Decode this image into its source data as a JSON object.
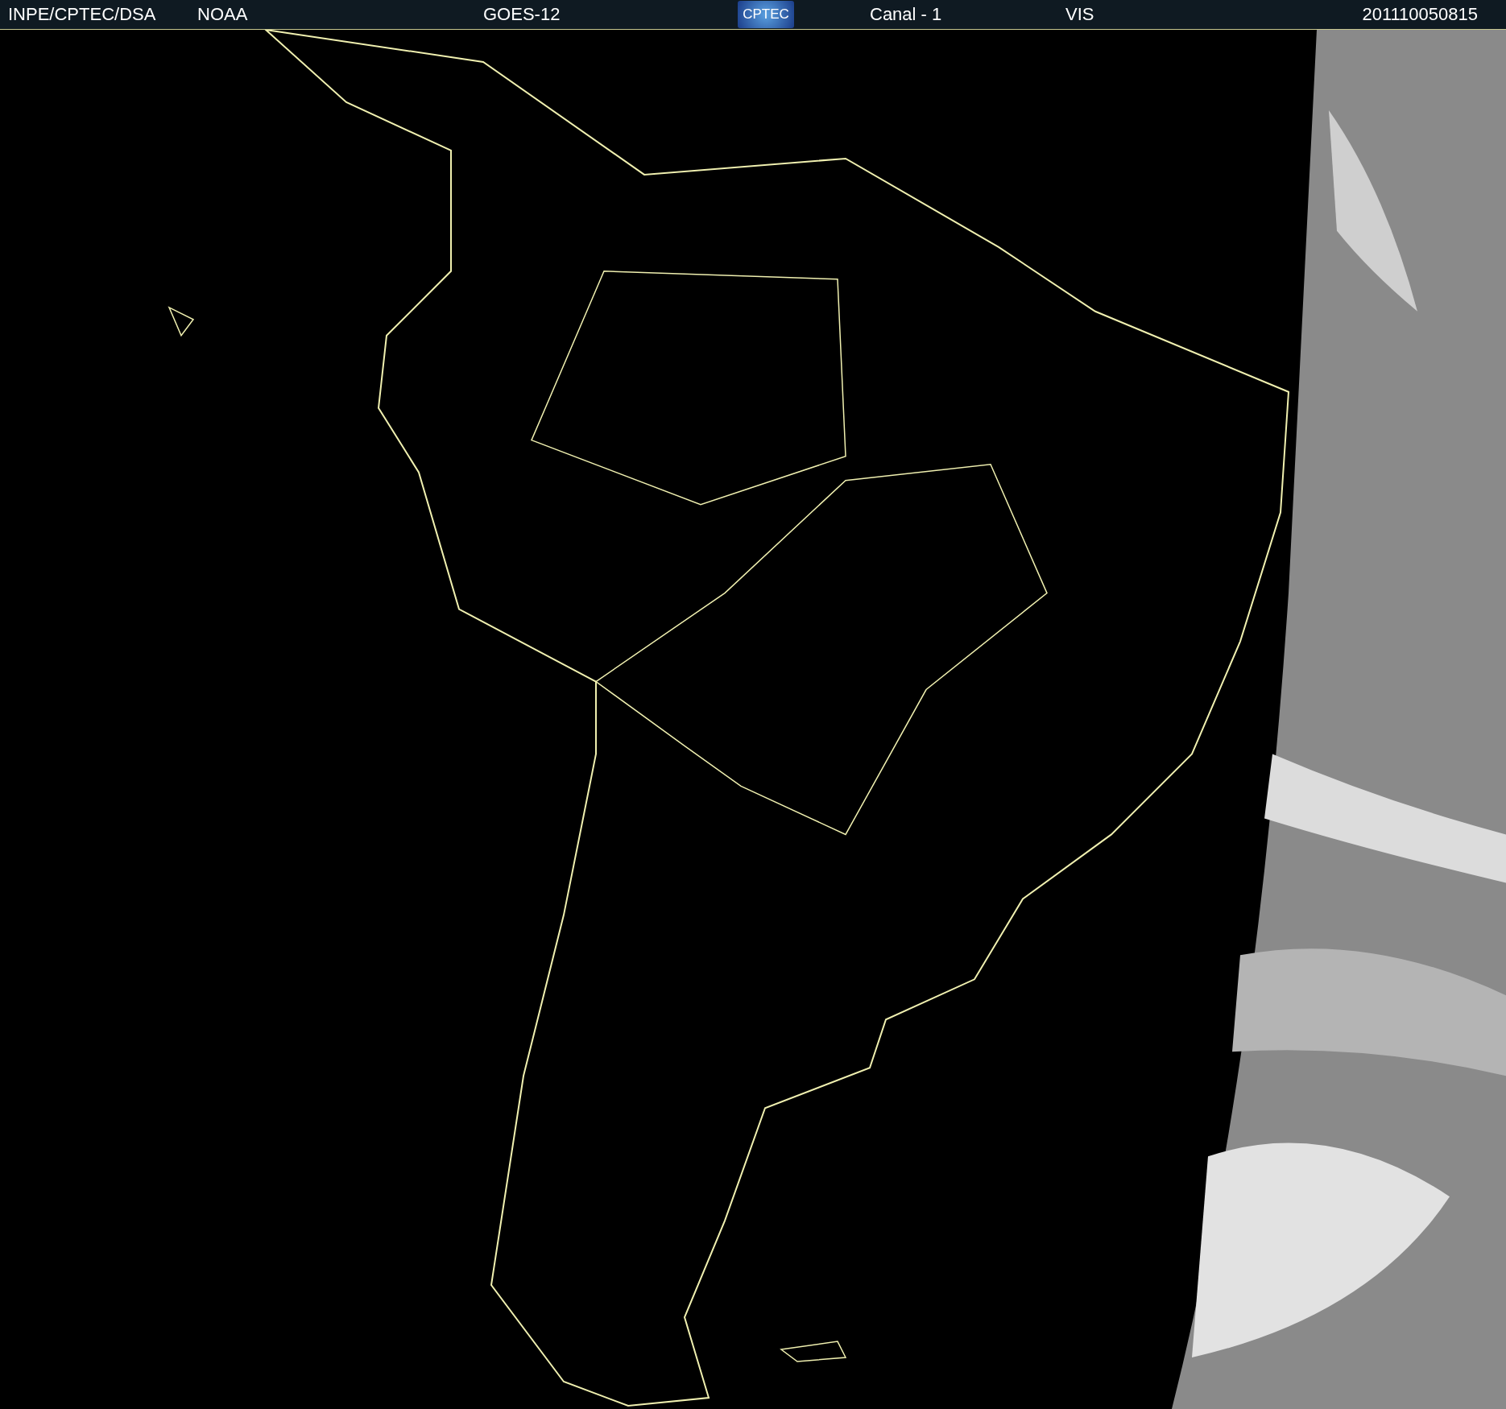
{
  "header": {
    "items": [
      {
        "kind": "text",
        "text": "INPE/CPTEC/DSA"
      },
      {
        "kind": "text",
        "text": "NOAA"
      },
      {
        "kind": "text",
        "text": "GOES-12"
      },
      {
        "kind": "logo",
        "text": "CPTEC"
      },
      {
        "kind": "text",
        "text": "Canal - 1"
      },
      {
        "kind": "text",
        "text": "VIS"
      },
      {
        "kind": "text",
        "text": "201110050815"
      }
    ]
  }
}
